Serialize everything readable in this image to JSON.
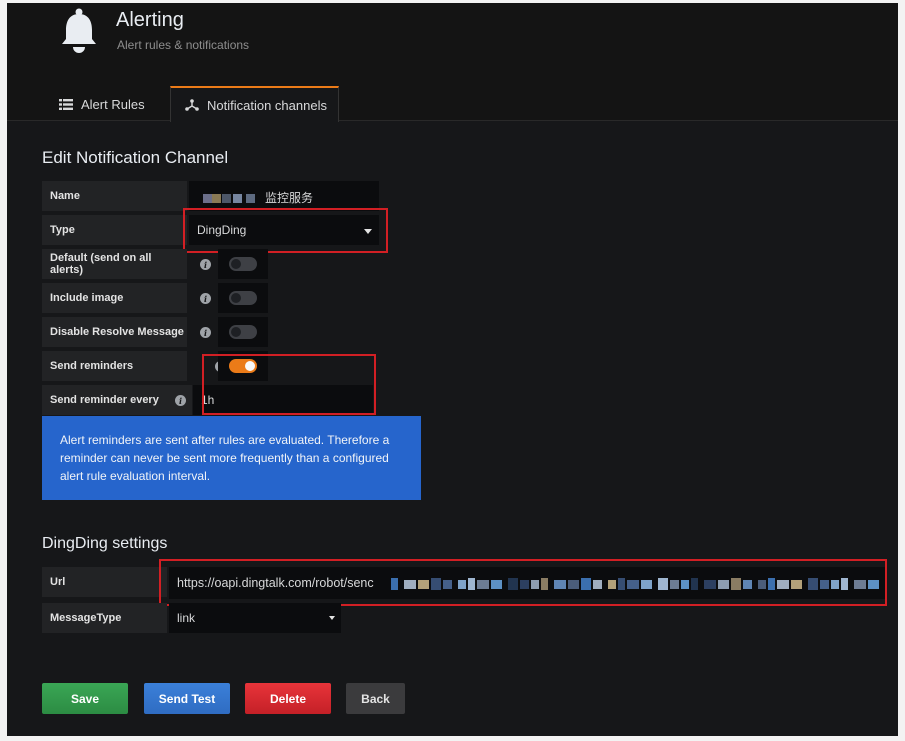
{
  "header": {
    "title": "Alerting",
    "subtitle": "Alert rules & notifications",
    "icon": "bell-icon"
  },
  "tabs": [
    {
      "label": "Alert Rules",
      "icon": "list-icon",
      "active": false
    },
    {
      "label": "Notification channels",
      "icon": "channels-icon",
      "active": true
    }
  ],
  "form": {
    "title": "Edit Notification Channel",
    "name_label": "Name",
    "name_value": "监控服务",
    "type_label": "Type",
    "type_value": "DingDing",
    "default_label": "Default (send on all alerts)",
    "default_on": false,
    "include_image_label": "Include image",
    "include_image_on": false,
    "disable_resolve_label": "Disable Resolve Message",
    "disable_resolve_on": false,
    "send_reminders_label": "Send reminders",
    "send_reminders_on": true,
    "reminder_every_label": "Send reminder every",
    "reminder_every_value": "1h",
    "reminder_info": "Alert reminders are sent after rules are evaluated. Therefore a reminder can never be sent more frequently than a configured alert rule evaluation interval."
  },
  "dingding": {
    "title": "DingDing settings",
    "url_label": "Url",
    "url_value": "https://oapi.dingtalk.com/robot/senc",
    "message_type_label": "MessageType",
    "message_type_value": "link"
  },
  "buttons": {
    "save": "Save",
    "send_test": "Send Test",
    "delete": "Delete",
    "back": "Back"
  },
  "colors": {
    "accent": "#eb7b18",
    "save": "#2c8c43",
    "test": "#2f6cc2",
    "delete": "#c42027",
    "info": "#2665cc",
    "highlight": "#d21f24"
  }
}
